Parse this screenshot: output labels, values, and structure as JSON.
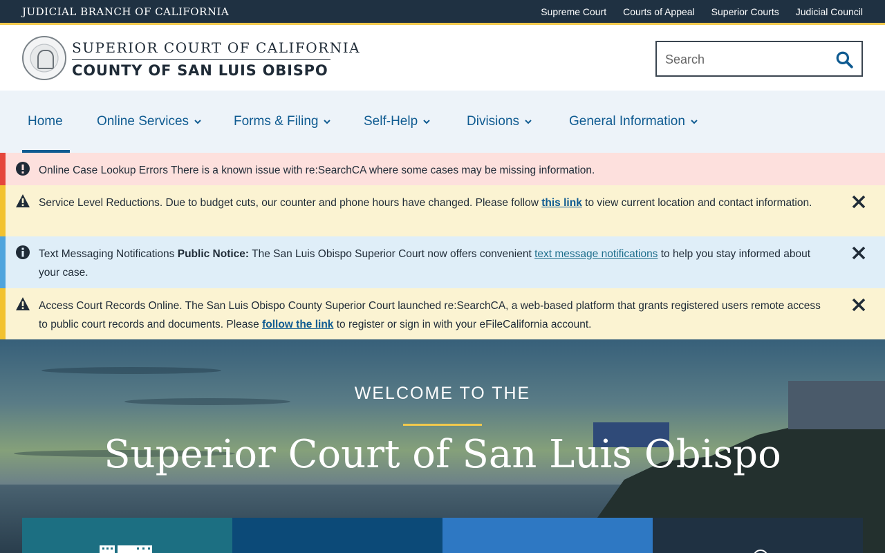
{
  "utility": {
    "branch": "JUDICIAL BRANCH OF CALIFORNIA",
    "links": [
      "Supreme Court",
      "Courts of Appeal",
      "Superior Courts",
      "Judicial Council"
    ]
  },
  "header": {
    "line1": "SUPERIOR COURT OF CALIFORNIA",
    "line2": "COUNTY OF SAN LUIS OBISPO",
    "search_placeholder": "Search"
  },
  "nav": {
    "items": [
      {
        "label": "Home"
      },
      {
        "label": "Online Services"
      },
      {
        "label": "Forms & Filing"
      },
      {
        "label": "Self-Help"
      },
      {
        "label": "Divisions"
      },
      {
        "label": "General Information"
      }
    ]
  },
  "alerts": {
    "red": {
      "text": "Online Case Lookup Errors There is a known issue with re:SearchCA where some cases may be missing information."
    },
    "yellow1": {
      "before": "Service Level Reductions. Due to budget cuts, our counter and phone hours have changed. Please follow ",
      "link": "this link",
      "after": " to view current location and contact information."
    },
    "blue": {
      "title": "Text Messaging Notifications ",
      "bold": "Public Notice:",
      "before": " The San Luis Obispo Superior Court now offers convenient ",
      "link": "text message notifications",
      "after": " to help you stay informed about your case."
    },
    "yellow2": {
      "before": "Access Court Records Online. The San Luis Obispo County Superior Court launched re:SearchCA, a web-based platform that grants registered users remote access to public court records and documents. Please ",
      "link": "follow the link",
      "after": " to register or sign in with your eFileCalifornia account."
    }
  },
  "hero": {
    "welcome": "WELCOME TO THE",
    "headline": "Superior Court of San Luis Obispo"
  },
  "colors": {
    "navy": "#1f3142",
    "gold": "#f2c94c",
    "link_blue": "#0f5b91",
    "alert_red": "#e5463b",
    "alert_yellow": "#f2c230",
    "alert_blue": "#4fa4dd"
  }
}
